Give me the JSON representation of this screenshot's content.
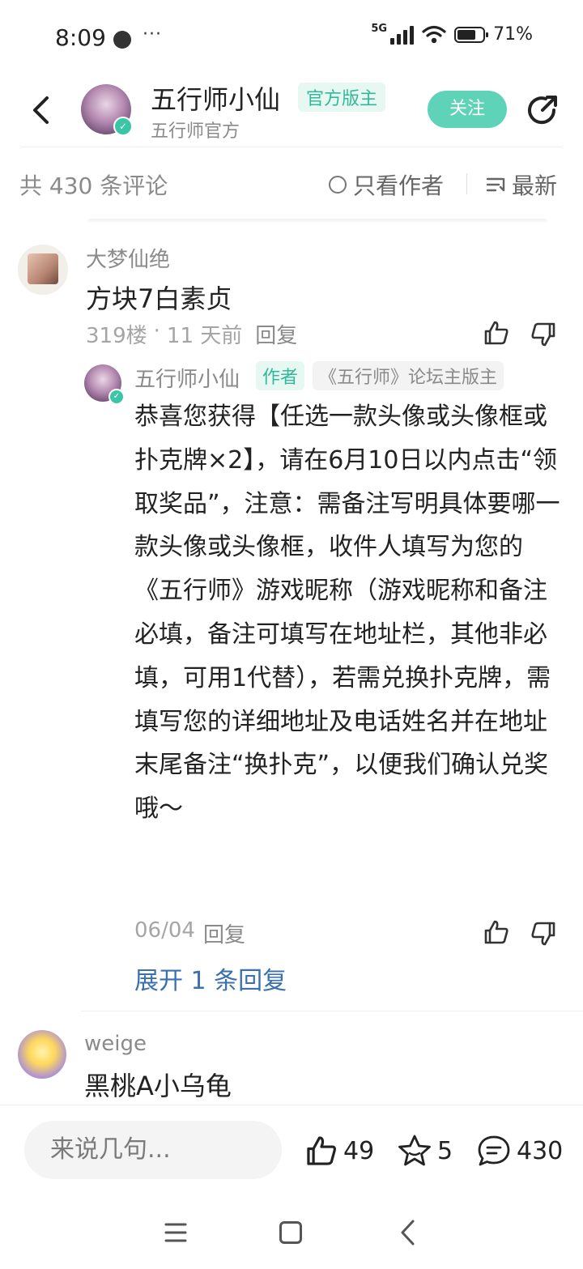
{
  "status_bar": {
    "time": "8:09",
    "more": "···",
    "network": "5G",
    "battery": "71%"
  },
  "header": {
    "name": "五行师小仙",
    "badge": "官方版主",
    "subtitle": "五行师官方",
    "follow_label": "关注"
  },
  "filter": {
    "count_text": "共 430 条评论",
    "author_only_label": "只看作者",
    "sort_label": "最新"
  },
  "comments": [
    {
      "user": "大梦仙绝",
      "text": "方块7白素贞",
      "floor": "319楼",
      "dot": "·",
      "time": "11 天前",
      "reply_label": "回复",
      "reply": {
        "user": "五行师小仙",
        "badge_author": "作者",
        "badge_mod": "《五行师》论坛主版主",
        "text": "恭喜您获得【任选一款头像或头像框或扑克牌×2】，请在6月10日以内点击“领取奖品”，注意：需备注写明具体要哪一款头像或头像框，收件人填写为您的《五行师》游戏昵称（游戏昵称和备注必填，备注可填写在地址栏，其他非必填，可用1代替），若需兑换扑克牌，需填写您的详细地址及电话姓名并在地址末尾备注“换扑克”，以便我们确认兑奖哦～",
        "date": "06/04",
        "reply_label": "回复"
      },
      "expand_label": "展开 1 条回复"
    },
    {
      "user": "weige",
      "text": "黑桃A小乌龟"
    }
  ],
  "bottom_bar": {
    "input_placeholder": "来说几句...",
    "likes": "49",
    "favorites": "5",
    "comments": "430"
  },
  "colors": {
    "accent": "#5fd3b8",
    "badge_text": "#33b89a",
    "link": "#3a6fb0"
  }
}
